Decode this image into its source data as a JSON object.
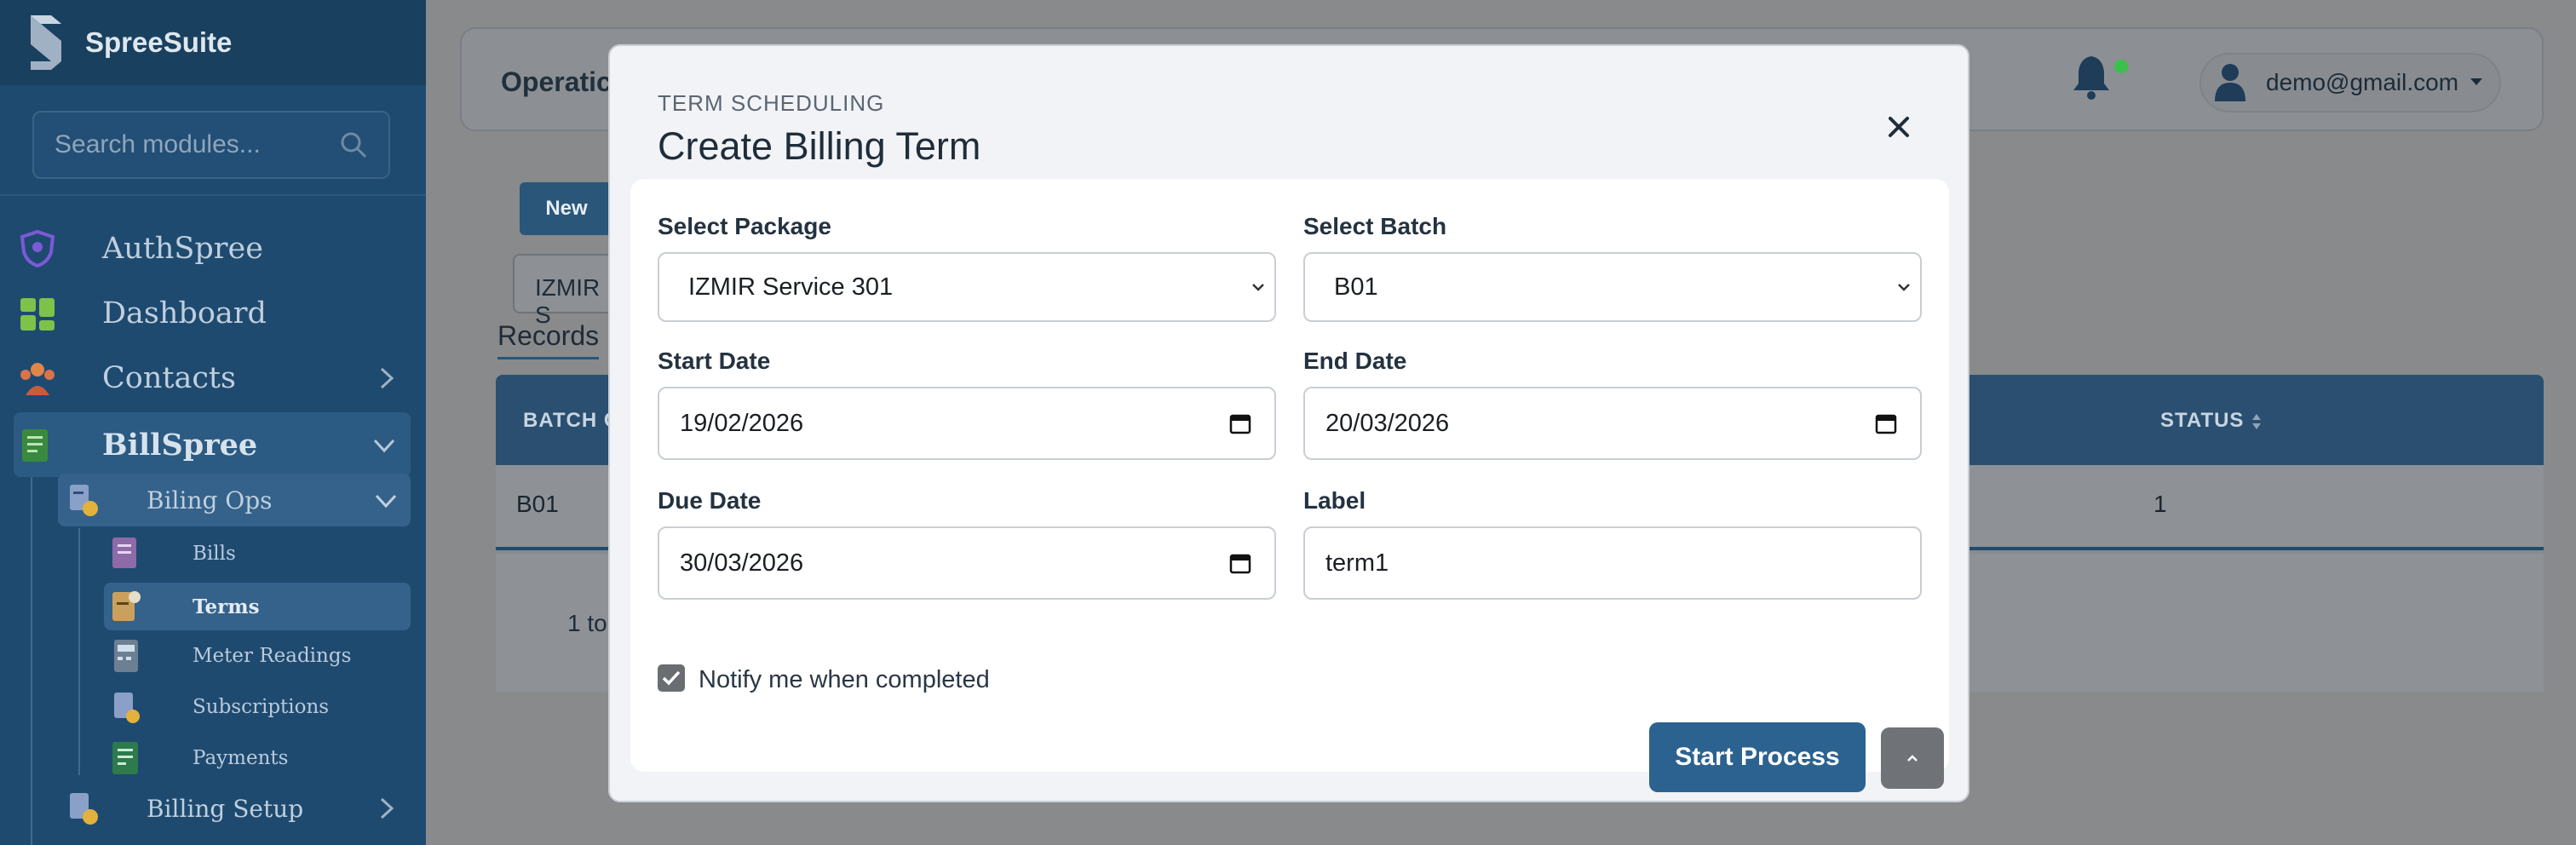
{
  "sidebar": {
    "brand": "SpreeSuite",
    "search_placeholder": "Search modules...",
    "items": [
      {
        "label": "AuthSpree",
        "icon": "shield-icon"
      },
      {
        "label": "Dashboard",
        "icon": "dashboard-icon"
      },
      {
        "label": "Contacts",
        "icon": "contacts-icon"
      },
      {
        "label": "BillSpree",
        "icon": "billspree-icon"
      }
    ],
    "group": {
      "label": "Biling Ops",
      "icon": "billing-ops-icon"
    },
    "sub_items": [
      {
        "label": "Bills",
        "icon": "bills-icon"
      },
      {
        "label": "Terms",
        "icon": "terms-icon"
      },
      {
        "label": "Meter Readings",
        "icon": "meter-icon"
      },
      {
        "label": "Subscriptions",
        "icon": "subscriptions-icon"
      },
      {
        "label": "Payments",
        "icon": "payments-icon"
      }
    ],
    "billing_setup": {
      "label": "Billing Setup",
      "icon": "billing-setup-icon"
    }
  },
  "header": {
    "title": "Operatic",
    "user_email": "demo@gmail.com"
  },
  "background": {
    "new_button": "New",
    "package_select": "IZMIR S",
    "records_tab": "Records",
    "table_headers": [
      "BATCH C",
      "STATUS"
    ],
    "row": {
      "batch": "B01",
      "status": "1"
    },
    "pager_text": "1 to"
  },
  "modal": {
    "eyebrow": "TERM SCHEDULING",
    "title": "Create Billing Term",
    "fields": {
      "package": {
        "label": "Select Package",
        "value": "IZMIR Service 301"
      },
      "batch": {
        "label": "Select Batch",
        "value": "B01"
      },
      "start_date": {
        "label": "Start Date",
        "value": "19/02/2026"
      },
      "end_date": {
        "label": "End Date",
        "value": "20/03/2026"
      },
      "due_date": {
        "label": "Due Date",
        "value": "30/03/2026"
      },
      "term_label": {
        "label": "Label",
        "value": "term1"
      }
    },
    "notify": {
      "label": "Notify me when completed",
      "checked": true
    },
    "start_button": "Start Process"
  },
  "colors": {
    "sidebar": "#1f4a70",
    "primary": "#2c628f",
    "overlay": "#888a8c",
    "modal_bg": "#f1f3f6",
    "notification_dot": "#3ac04b"
  }
}
